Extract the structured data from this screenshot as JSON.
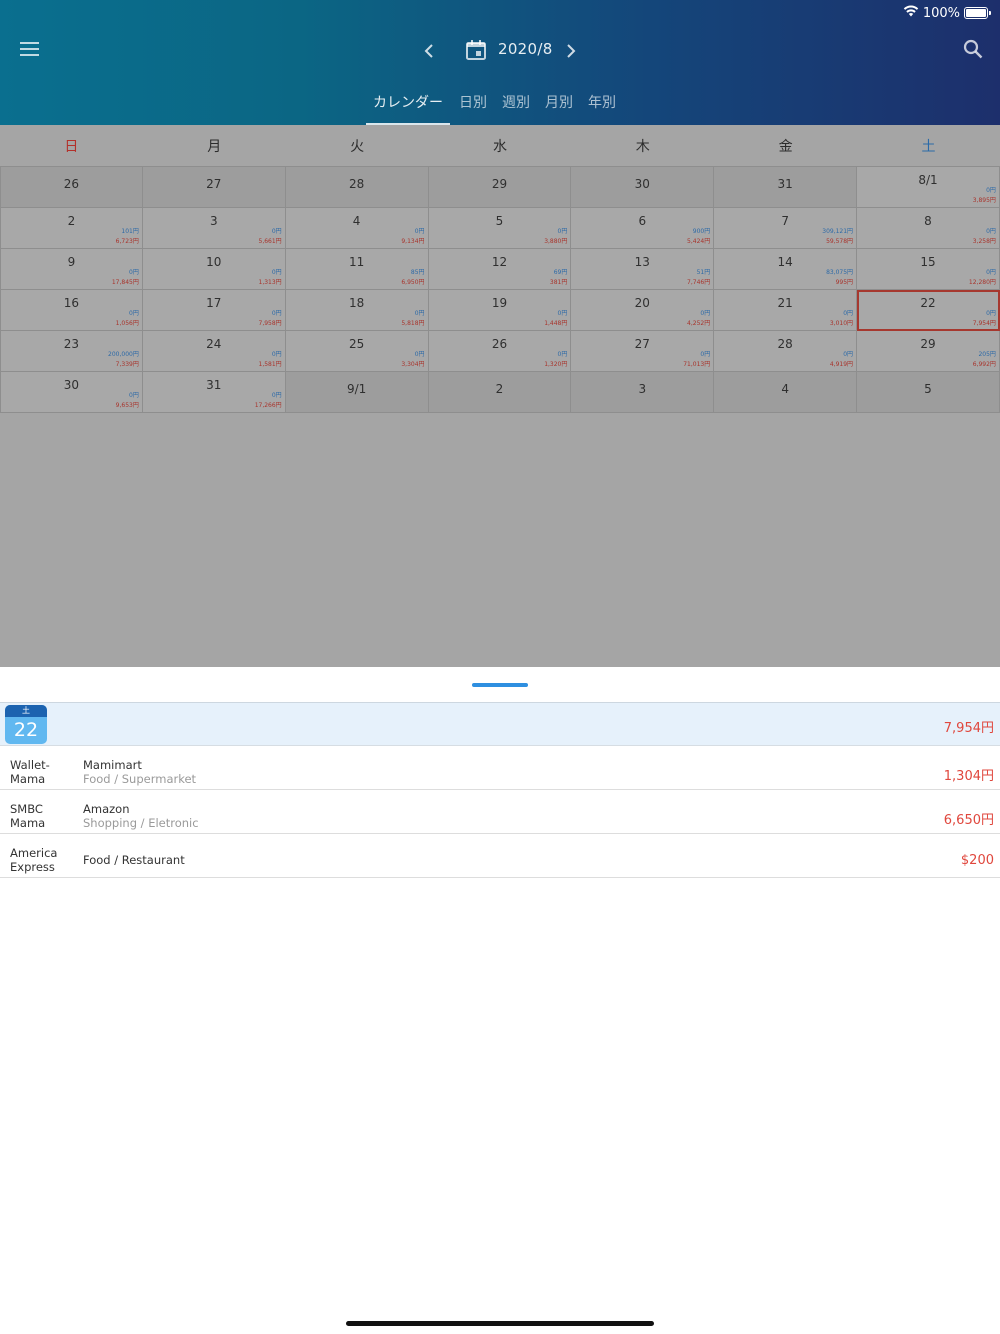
{
  "status": {
    "battery_text": "100%"
  },
  "header": {
    "month": "2020/8",
    "tabs": [
      {
        "label": "カレンダー",
        "active": true
      },
      {
        "label": "日別",
        "active": false
      },
      {
        "label": "週別",
        "active": false
      },
      {
        "label": "月別",
        "active": false
      },
      {
        "label": "年別",
        "active": false
      }
    ]
  },
  "calendar": {
    "weekdays": [
      "日",
      "月",
      "火",
      "水",
      "木",
      "金",
      "土"
    ],
    "cells": [
      {
        "day": "26",
        "other": true
      },
      {
        "day": "27",
        "other": true
      },
      {
        "day": "28",
        "other": true
      },
      {
        "day": "29",
        "other": true
      },
      {
        "day": "30",
        "other": true
      },
      {
        "day": "31",
        "other": true
      },
      {
        "day": "8/1",
        "income": "0円",
        "expense": "3,895円"
      },
      {
        "day": "2",
        "income": "101円",
        "expense": "6,723円"
      },
      {
        "day": "3",
        "income": "0円",
        "expense": "5,661円"
      },
      {
        "day": "4",
        "income": "0円",
        "expense": "9,134円"
      },
      {
        "day": "5",
        "income": "0円",
        "expense": "3,880円"
      },
      {
        "day": "6",
        "income": "900円",
        "expense": "5,424円"
      },
      {
        "day": "7",
        "income": "309,121円",
        "expense": "59,578円"
      },
      {
        "day": "8",
        "income": "0円",
        "expense": "3,258円"
      },
      {
        "day": "9",
        "income": "0円",
        "expense": "17,845円"
      },
      {
        "day": "10",
        "income": "0円",
        "expense": "1,313円"
      },
      {
        "day": "11",
        "income": "85円",
        "expense": "6,950円"
      },
      {
        "day": "12",
        "income": "69円",
        "expense": "381円"
      },
      {
        "day": "13",
        "income": "51円",
        "expense": "7,746円"
      },
      {
        "day": "14",
        "income": "83,075円",
        "expense": "995円"
      },
      {
        "day": "15",
        "income": "0円",
        "expense": "12,280円"
      },
      {
        "day": "16",
        "income": "0円",
        "expense": "1,056円"
      },
      {
        "day": "17",
        "income": "0円",
        "expense": "7,958円"
      },
      {
        "day": "18",
        "income": "0円",
        "expense": "5,818円"
      },
      {
        "day": "19",
        "income": "0円",
        "expense": "1,448円"
      },
      {
        "day": "20",
        "income": "0円",
        "expense": "4,252円"
      },
      {
        "day": "21",
        "income": "0円",
        "expense": "3,010円"
      },
      {
        "day": "22",
        "income": "0円",
        "expense": "7,954円",
        "selected": true
      },
      {
        "day": "23",
        "income": "200,000円",
        "expense": "7,339円"
      },
      {
        "day": "24",
        "income": "0円",
        "expense": "1,581円"
      },
      {
        "day": "25",
        "income": "0円",
        "expense": "3,304円"
      },
      {
        "day": "26",
        "income": "0円",
        "expense": "1,320円"
      },
      {
        "day": "27",
        "income": "0円",
        "expense": "71,013円"
      },
      {
        "day": "28",
        "income": "0円",
        "expense": "4,919円"
      },
      {
        "day": "29",
        "income": "205円",
        "expense": "6,992円"
      },
      {
        "day": "30",
        "income": "0円",
        "expense": "9,653円"
      },
      {
        "day": "31",
        "income": "0円",
        "expense": "17,266円"
      },
      {
        "day": "9/1",
        "other": true
      },
      {
        "day": "2",
        "other": true
      },
      {
        "day": "3",
        "other": true
      },
      {
        "day": "4",
        "other": true
      },
      {
        "day": "5",
        "other": true
      }
    ]
  },
  "sheet": {
    "selected_weekday": "土",
    "selected_day": "22",
    "day_total": "7,954円",
    "transactions": [
      {
        "account": "Wallet-\nMama",
        "payee": "Mamimart",
        "category": "Food / Supermarket",
        "amount": "1,304円"
      },
      {
        "account": "SMBC\nMama",
        "payee": "Amazon",
        "category": "Shopping / Eletronic",
        "amount": "6,650円"
      },
      {
        "account": "America\nExpress",
        "payee": "",
        "category": "Food / Restaurant",
        "amount": "$200"
      }
    ]
  },
  "colors": {
    "expense": "#e0473d",
    "income": "#2d6aa7",
    "accent": "#2e8fe0"
  }
}
